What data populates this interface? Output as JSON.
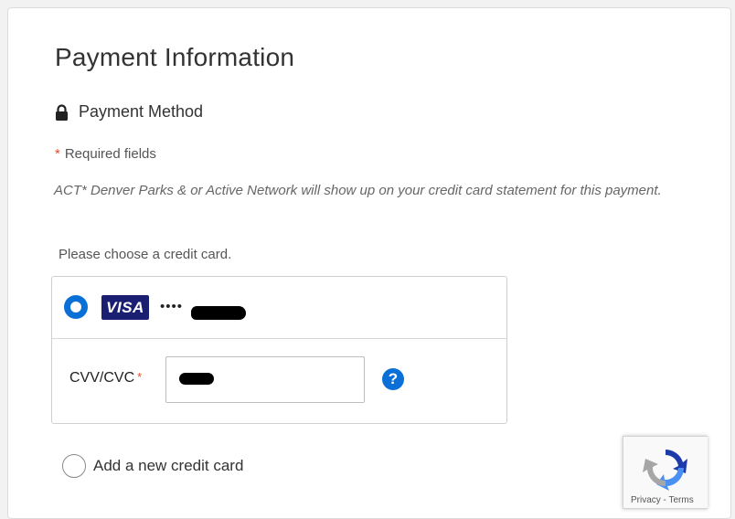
{
  "page": {
    "title": "Payment Information",
    "payment_method_label": "Payment Method",
    "required_star": "*",
    "required_text": "Required fields",
    "statement_notice": "ACT* Denver Parks & or Active Network will show up on your credit card statement for this payment.",
    "choose_card_prompt": "Please choose a credit card."
  },
  "saved_card": {
    "brand": "VISA",
    "masked_prefix": "••••",
    "selected": true,
    "cvv_label": "CVV/CVC",
    "cvv_required_star": "*",
    "help_glyph": "?"
  },
  "new_card": {
    "label": "Add a new credit card",
    "selected": false
  },
  "recaptcha": {
    "links": "Privacy - Terms"
  },
  "colors": {
    "accent": "#0a6fd6",
    "visa_blue": "#1a1f71",
    "required_star": "#e34d2c"
  },
  "icons": {
    "method": "lock-icon",
    "help": "question-circle-icon",
    "recaptcha": "recaptcha-logo-icon"
  }
}
